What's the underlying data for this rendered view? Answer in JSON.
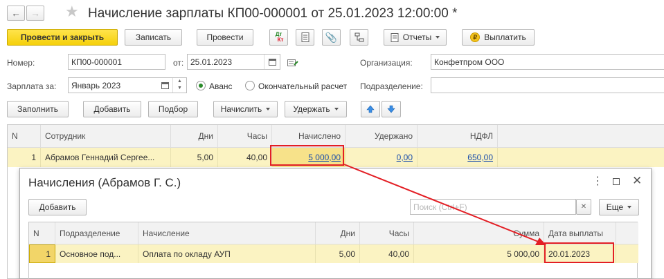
{
  "window": {
    "title": "Начисление зарплаты КП00-000001 от 25.01.2023 12:00:00 *"
  },
  "toolbar": {
    "post_close": "Провести и закрыть",
    "write": "Записать",
    "post": "Провести",
    "reports": "Отчеты",
    "pay": "Выплатить",
    "dt_kt_top": "Дт",
    "dt_kt_bottom": "Кт"
  },
  "form": {
    "number_label": "Номер:",
    "number_value": "КП00-000001",
    "date_label": "от:",
    "date_value": "25.01.2023",
    "org_label": "Организация:",
    "org_value": "Конфетпром ООО",
    "salary_for_label": "Зарплата за:",
    "salary_for_value": "Январь 2023",
    "radio_advance": "Аванс",
    "radio_final": "Окончательный расчет",
    "dept_label": "Подразделение:",
    "dept_value": ""
  },
  "actions": {
    "fill": "Заполнить",
    "add": "Добавить",
    "select": "Подбор",
    "accrue": "Начислить",
    "withhold": "Удержать"
  },
  "main_table": {
    "columns": [
      "N",
      "Сотрудник",
      "Дни",
      "Часы",
      "Начислено",
      "Удержано",
      "НДФЛ"
    ],
    "rows": [
      {
        "n": "1",
        "employee": "Абрамов Геннадий Сергее...",
        "days": "5,00",
        "hours": "40,00",
        "accrued": "5 000,00",
        "withheld": "0,00",
        "ndfl": "650,00"
      }
    ]
  },
  "dialog": {
    "title": "Начисления (Абрамов Г. С.)",
    "add": "Добавить",
    "search_placeholder": "Поиск (Ctrl+F)",
    "more": "Еще",
    "columns": [
      "N",
      "Подразделение",
      "Начисление",
      "Дни",
      "Часы",
      "Сумма",
      "Дата выплаты"
    ],
    "rows": [
      {
        "n": "1",
        "dept": "Основное под...",
        "accrual": "Оплата по окладу АУП",
        "days": "5,00",
        "hours": "40,00",
        "sum": "5 000,00",
        "pay_date": "20.01.2023"
      }
    ]
  },
  "colors": {
    "highlight": "#e31e24",
    "row_selected": "#fbf3c2",
    "primary_button": "#f5d00a"
  }
}
